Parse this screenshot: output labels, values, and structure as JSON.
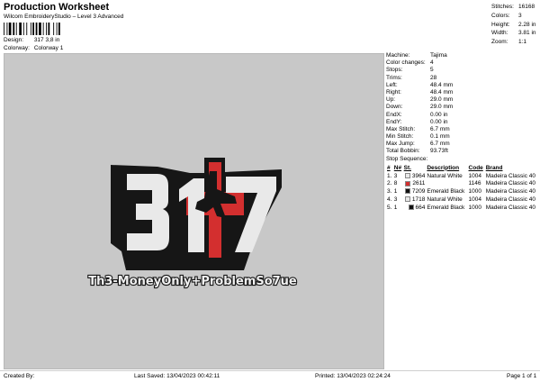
{
  "header": {
    "title": "Production Worksheet",
    "subtitle": "Wilcom EmbroideryStudio – Level 3 Advanced",
    "design_label": "Design:",
    "design_value": "317 3,8 in",
    "colorway_label": "Colorway:",
    "colorway_value": "Colorway 1"
  },
  "stats": [
    {
      "label": "Stitches:",
      "value": "16168"
    },
    {
      "label": "Colors:",
      "value": "3"
    },
    {
      "label": "Height:",
      "value": "2.28 in"
    },
    {
      "label": "Width:",
      "value": "3.81 in"
    },
    {
      "label": "Zoom:",
      "value": "1:1"
    }
  ],
  "design": {
    "caption": "Th3-MoneyOnly+ProblemSo7ue",
    "colors": {
      "white": "#e9e9e9",
      "red": "#d32f2f",
      "black": "#161616",
      "bg": "#c8c8c8"
    }
  },
  "machine_info": [
    {
      "label": "Machine:",
      "value": "Tajima"
    },
    {
      "label": "Color changes:",
      "value": "4"
    },
    {
      "label": "Stops:",
      "value": "5"
    },
    {
      "label": "Trims:",
      "value": "28"
    },
    {
      "label": "Left:",
      "value": "48.4 mm"
    },
    {
      "label": "Right:",
      "value": "48.4 mm"
    },
    {
      "label": "Up:",
      "value": "29.0 mm"
    },
    {
      "label": "Down:",
      "value": "29.0 mm"
    },
    {
      "label": "EndX:",
      "value": "0.00 in"
    },
    {
      "label": "EndY:",
      "value": "0.00 in"
    },
    {
      "label": "Max Stitch:",
      "value": "6.7 mm"
    },
    {
      "label": "Min Stitch:",
      "value": "0.1 mm"
    },
    {
      "label": "Max Jump:",
      "value": "6.7 mm"
    },
    {
      "label": "Total Bobbin:",
      "value": "93.73ft"
    }
  ],
  "stop_sequence": {
    "title": "Stop Sequence:",
    "headers": [
      "#",
      "N#",
      "St.",
      "Description",
      "Code",
      "Brand"
    ],
    "rows": [
      {
        "idx": "1.",
        "n": "3",
        "color": "#e8e8e8",
        "st": "3964",
        "desc": "Natural White",
        "code": "1004",
        "brand": "Madeira Classic 40"
      },
      {
        "idx": "2.",
        "n": "8",
        "color": "#d32f2f",
        "st": "2611",
        "desc": "",
        "code": "1146",
        "brand": "Madeira Classic 40"
      },
      {
        "idx": "3.",
        "n": "1",
        "color": "#111111",
        "st": "7209",
        "desc": "Emerald Black",
        "code": "1000",
        "brand": "Madeira Classic 40"
      },
      {
        "idx": "4.",
        "n": "3",
        "color": "#e8e8e8",
        "st": "1718",
        "desc": "Natural White",
        "code": "1004",
        "brand": "Madeira Classic 40"
      },
      {
        "idx": "5.",
        "n": "1",
        "color": "#111111",
        "st": "664",
        "desc": "Emerald Black",
        "code": "1000",
        "brand": "Madeira Classic 40"
      }
    ]
  },
  "footer": {
    "created_by": "Created By:",
    "last_saved": "Last Saved: 13/04/2023 00:42:11",
    "printed": "Printed: 13/04/2023 02:24:24",
    "page": "Page 1 of 1"
  }
}
